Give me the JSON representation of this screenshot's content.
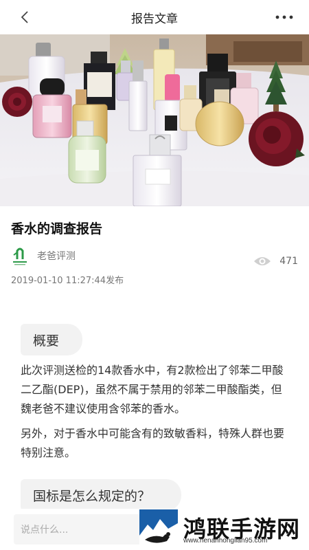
{
  "nav": {
    "title": "报告文章"
  },
  "article": {
    "title": "香水的调查报告",
    "author": "老爸评测",
    "views": "471",
    "date": "2019-01-10 11:27:44发布"
  },
  "sections": [
    {
      "heading": "概要",
      "paragraphs": [
        "此次评测送检的14款香水中，有2款检出了邻苯二甲酸二乙酯(DEP)，虽然不属于禁用的邻苯二甲酸酯类，但魏老爸不建议使用含邻苯的香水。",
        "另外，对于香水中可能含有的致敏香料，特殊人群也要特别注意。"
      ]
    },
    {
      "heading": "国标是怎么规定的？"
    }
  ],
  "comment": {
    "placeholder": "说点什么..."
  },
  "watermark": {
    "brand": "鸿联手游网",
    "url": "www.henanhonglian95.com"
  }
}
